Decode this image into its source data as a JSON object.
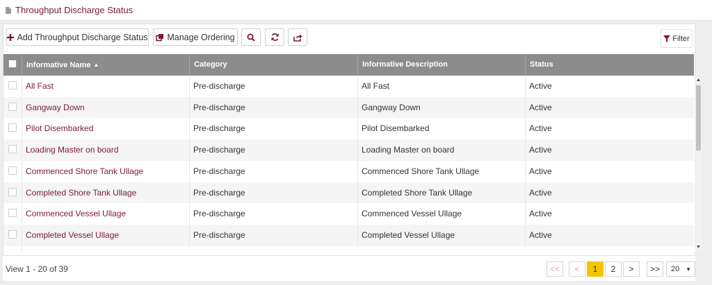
{
  "header": {
    "title": "Throughput Discharge Status"
  },
  "toolbar": {
    "add_label": "Add Throughput Discharge Status",
    "manage_label": "Manage Ordering",
    "filter_label": "Filter"
  },
  "grid": {
    "columns": [
      "Informative Name",
      "Category",
      "Informative Description",
      "Status"
    ],
    "rows": [
      [
        "All Fast",
        "Pre-discharge",
        "All Fast",
        "Active"
      ],
      [
        "Gangway Down",
        "Pre-discharge",
        "Gangway Down",
        "Active"
      ],
      [
        "Pilot Disembarked",
        "Pre-discharge",
        "Pilot Disembarked",
        "Active"
      ],
      [
        "Loading Master on board",
        "Pre-discharge",
        "Loading Master on board",
        "Active"
      ],
      [
        "Commenced Shore Tank Ullage",
        "Pre-discharge",
        "Commenced Shore Tank Ullage",
        "Active"
      ],
      [
        "Completed Shore Tank Ullage",
        "Pre-discharge",
        "Completed Shore Tank Ullage",
        "Active"
      ],
      [
        "Commenced Vessel Ullage",
        "Pre-discharge",
        "Commenced Vessel Ullage",
        "Active"
      ],
      [
        "Completed Vessel Ullage",
        "Pre-discharge",
        "Completed Vessel Ullage",
        "Active"
      ]
    ]
  },
  "pager": {
    "view_text": "View 1 - 20 of 39",
    "first": "<<",
    "prev": "<",
    "pages": [
      "1",
      "2"
    ],
    "next": ">",
    "last": ">>",
    "page_size": "20"
  },
  "colors": {
    "accent": "#7a1a34",
    "header_bg": "#8c8c8c",
    "active_page": "#f5c400"
  }
}
